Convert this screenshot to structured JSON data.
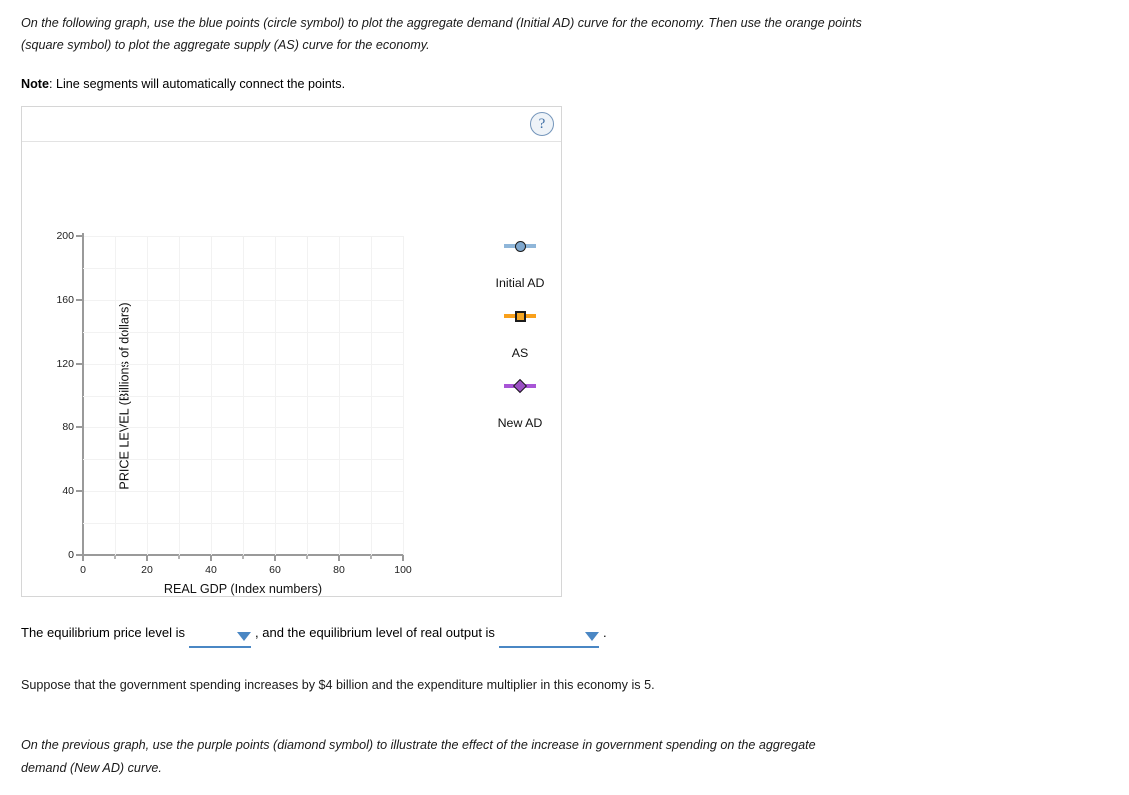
{
  "prompt": {
    "line1": "On the following graph, use the blue points (circle symbol) to plot the aggregate demand (Initial AD) curve for the economy. Then use the orange points",
    "line2": "(square symbol) to plot the aggregate supply (AS) curve for the economy.",
    "note_label": "Note",
    "note_text": ": Line segments will automatically connect the points."
  },
  "widget": {
    "help_icon": "?"
  },
  "chart_data": {
    "type": "scatter",
    "title": "",
    "xlabel": "REAL GDP (Index numbers)",
    "ylabel": "PRICE LEVEL (Billions of dollars)",
    "xlim": [
      0,
      100
    ],
    "ylim": [
      0,
      200
    ],
    "x_ticks": [
      "0",
      "20",
      "40",
      "60",
      "80",
      "100"
    ],
    "x_tick_values": [
      0,
      20,
      40,
      60,
      80,
      100
    ],
    "x_minor_step": 10,
    "y_ticks": [
      "0",
      "40",
      "80",
      "120",
      "160",
      "200"
    ],
    "y_tick_values": [
      0,
      40,
      80,
      120,
      160,
      200
    ],
    "y_minor_step": 20,
    "grid": true,
    "legend_position": "right",
    "series": [
      {
        "name": "Initial AD",
        "symbol": "circle",
        "marker_color": "#7fa8cf",
        "line_color": "#8fb6d9",
        "edge_color": "#1b1b1b",
        "values": []
      },
      {
        "name": "AS",
        "symbol": "square",
        "marker_color": "#f5a623",
        "line_color": "#f9a01b",
        "edge_color": "#1b1b1b",
        "values": []
      },
      {
        "name": "New AD",
        "symbol": "diamond",
        "marker_color": "#9b4fc4",
        "line_color": "#a855d6",
        "edge_color": "#1b1b1b",
        "values": []
      }
    ]
  },
  "answer": {
    "text_before": "The equilibrium price level is",
    "dropdown1_value": "",
    "text_middle": ", and the equilibrium level of real output is",
    "dropdown2_value": "",
    "text_after": "."
  },
  "paragraphs": {
    "suppose": "Suppose that the government spending increases by $4 billion and the expenditure multiplier in this economy is 5.",
    "purple_line1": "On the previous graph, use the purple points (diamond symbol) to illustrate the effect of the increase in government spending on the aggregate",
    "purple_line2": "demand (New AD) curve."
  }
}
